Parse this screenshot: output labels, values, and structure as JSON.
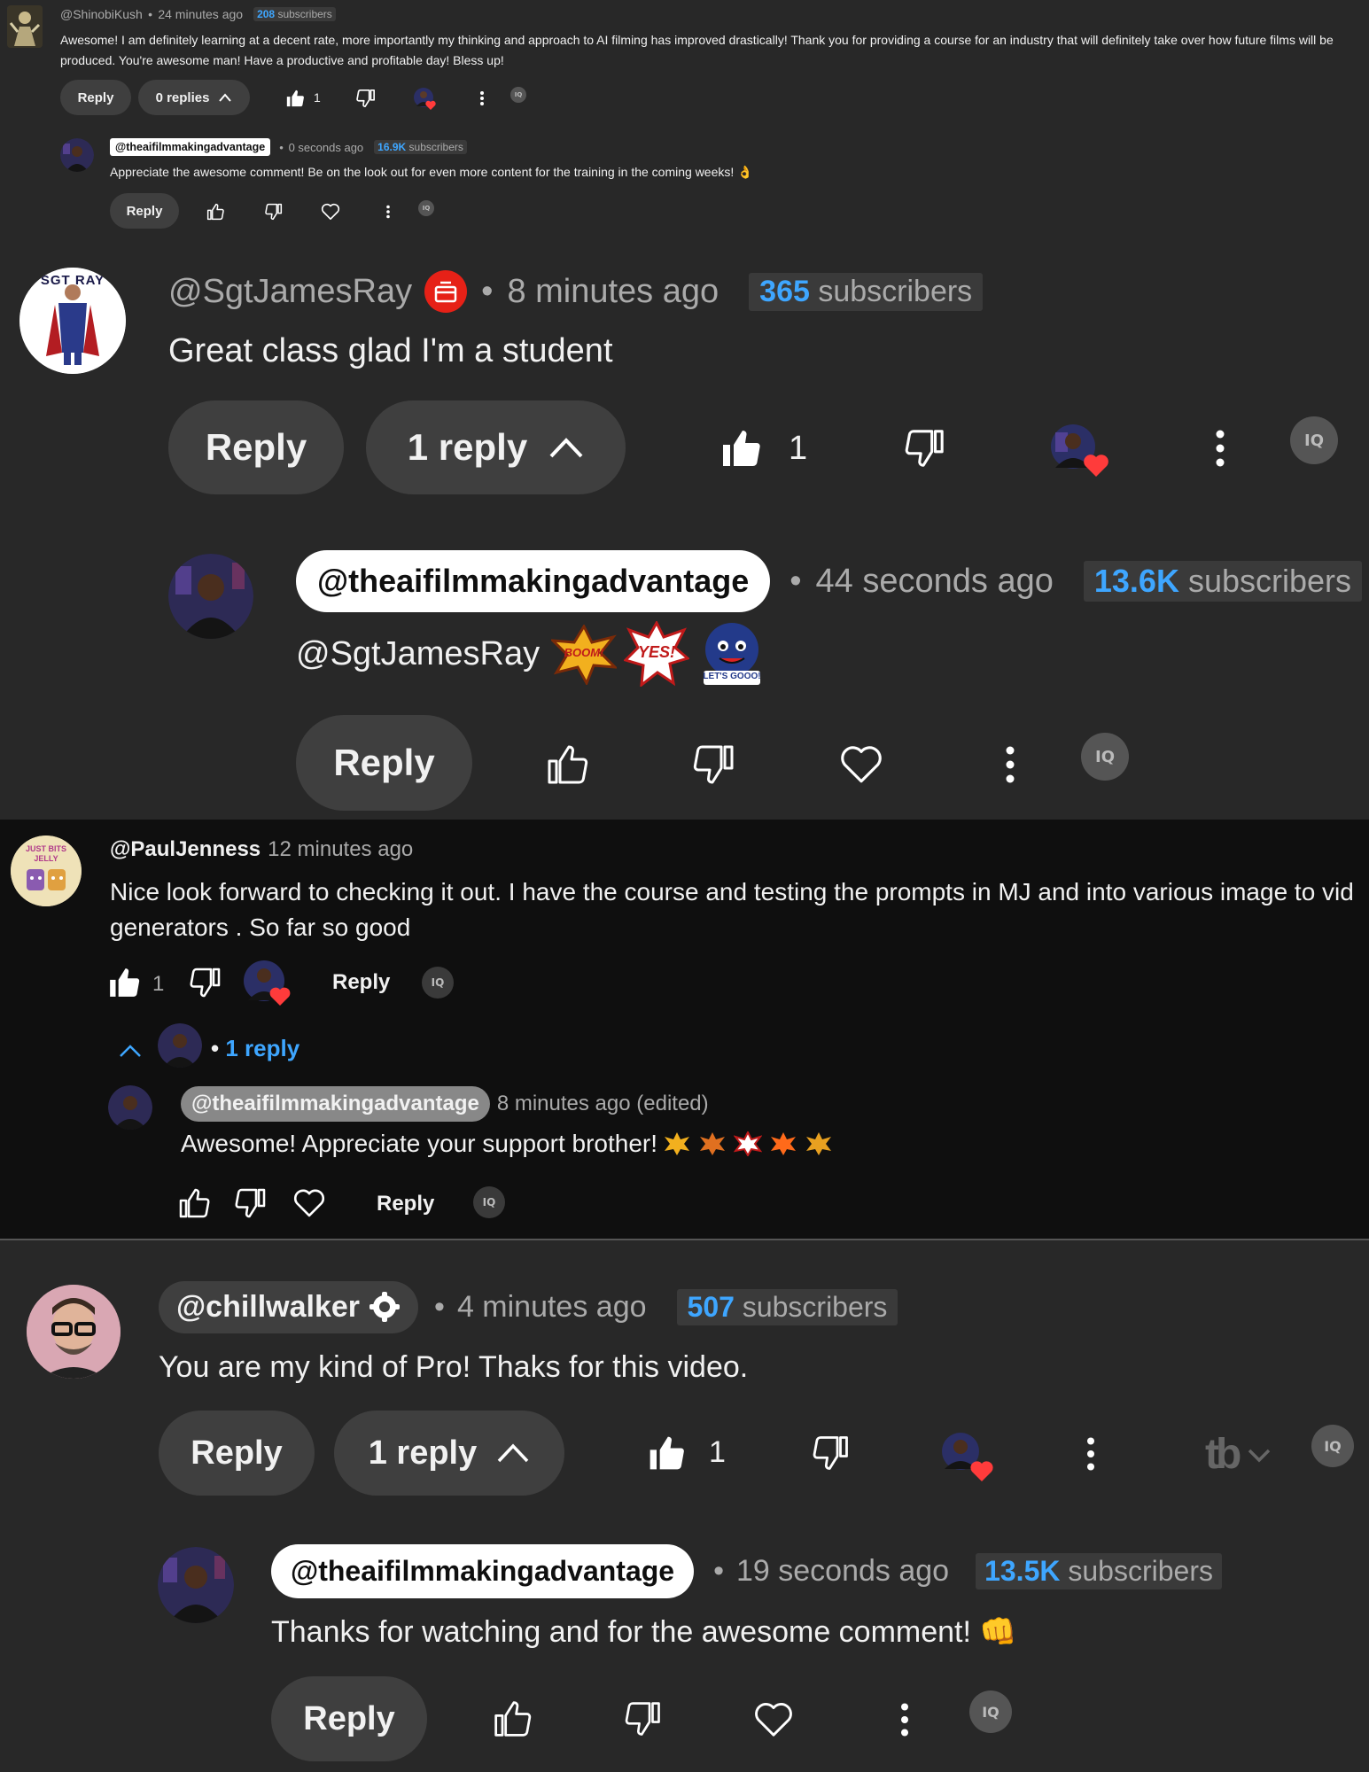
{
  "comments": [
    {
      "handle": "@ShinobiKush",
      "time": "24 minutes ago",
      "subs_num": "208",
      "subs_word": "subscribers",
      "text": "Awesome! I am definitely learning at a decent rate, more importantly my thinking and approach to AI filming has improved drastically! Thank you for providing a course for an industry that will definitely take over how future films will be produced. You're awesome man! Have a productive and profitable day! Bless up!",
      "reply_label": "Reply",
      "replies_label": "0 replies",
      "likes": "1",
      "reply": {
        "handle": "@theaifilmmakingadvantage",
        "time": "0 seconds ago",
        "subs_num": "16.9K",
        "subs_word": "subscribers",
        "text": "Appreciate the awesome comment! Be on the look out for even more content for the training in the coming weeks! 👌",
        "reply_label": "Reply"
      }
    },
    {
      "handle": "@SgtJamesRay",
      "time": "8 minutes ago",
      "subs_num": "365",
      "subs_word": "subscribers",
      "text": "Great class glad I'm a student",
      "reply_label": "Reply",
      "replies_label": "1 reply",
      "likes": "1",
      "avatar_text": "SGT RAY",
      "reply": {
        "handle": "@theaifilmmakingadvantage",
        "time": "44 seconds ago",
        "subs_num": "13.6K",
        "subs_word": "subscribers",
        "text": "@SgtJamesRay",
        "stickers": [
          "BOOM!",
          "YES!",
          "LET'S GOOO!"
        ],
        "reply_label": "Reply"
      }
    },
    {
      "handle": "@PaulJenness",
      "time": "12 minutes ago",
      "text": "Nice look forward to checking it out. I have the course and testing the prompts in MJ and into various image to vid generators .  So far so good",
      "likes": "1",
      "reply_label": "Reply",
      "replies_label": "1 reply",
      "avatar_text": "JUST BITS JELLY",
      "reply": {
        "handle": "@theaifilmmakingadvantage",
        "time": "8 minutes ago (edited)",
        "text": "Awesome! Appreciate your support brother!",
        "reply_label": "Reply"
      }
    },
    {
      "handle": "@chillwalker",
      "time": "4 minutes ago",
      "subs_num": "507",
      "subs_word": "subscribers",
      "text": "You are my kind of Pro! Thaks for this video.",
      "reply_label": "Reply",
      "replies_label": "1 reply",
      "likes": "1",
      "tb_logo": "tb",
      "reply": {
        "handle": "@theaifilmmakingadvantage",
        "time": "19 seconds ago",
        "subs_num": "13.5K",
        "subs_word": "subscribers",
        "text": "Thanks for watching and for the awesome comment! 👊",
        "reply_label": "Reply"
      }
    }
  ],
  "iq_label": "IQ",
  "colors": {
    "background": "#282828",
    "dark_section": "#0f0f0f",
    "link_blue": "#3ea6ff",
    "heart_red": "#ff3b3b"
  }
}
